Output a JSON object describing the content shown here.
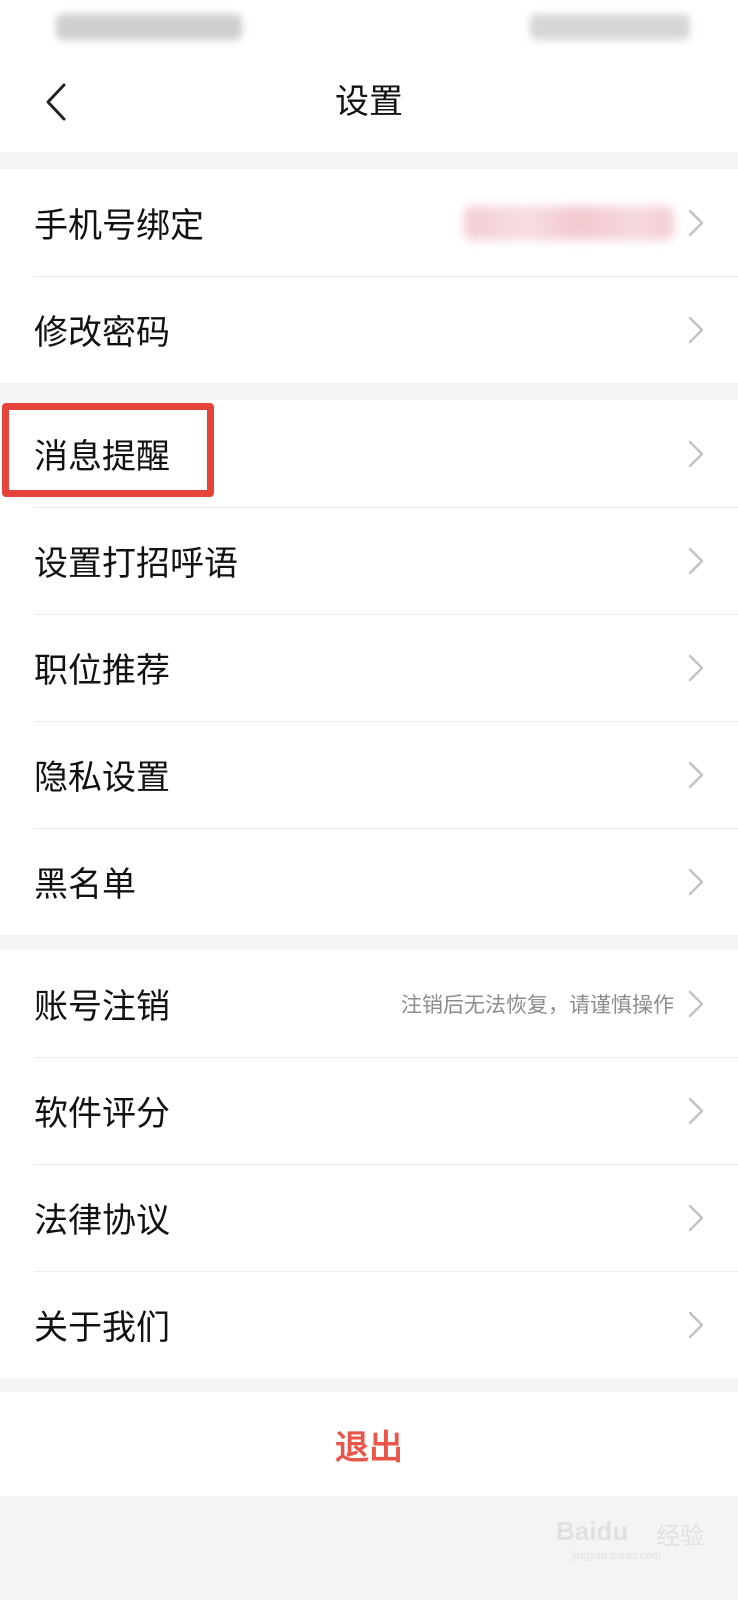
{
  "header": {
    "title": "设置"
  },
  "groups": [
    {
      "items": [
        {
          "label": "手机号绑定"
        },
        {
          "label": "修改密码"
        }
      ]
    },
    {
      "items": [
        {
          "label": "消息提醒"
        },
        {
          "label": "设置打招呼语"
        },
        {
          "label": "职位推荐"
        },
        {
          "label": "隐私设置"
        },
        {
          "label": "黑名单"
        }
      ]
    },
    {
      "items": [
        {
          "label": "账号注销",
          "hint": "注销后无法恢复，请谨慎操作"
        },
        {
          "label": "软件评分"
        },
        {
          "label": "法律协议"
        },
        {
          "label": "关于我们"
        }
      ]
    }
  ],
  "logout": {
    "label": "退出"
  },
  "watermark": {
    "text": "Baidu",
    "cn": "经验",
    "sub": "jingyan.baidu.com"
  },
  "colors": {
    "accent": "#e8564a",
    "highlight": "#e5443a",
    "background": "#f4f4f4"
  },
  "icons": {
    "back": "chevron-left-icon",
    "row_arrow": "chevron-right-icon"
  }
}
